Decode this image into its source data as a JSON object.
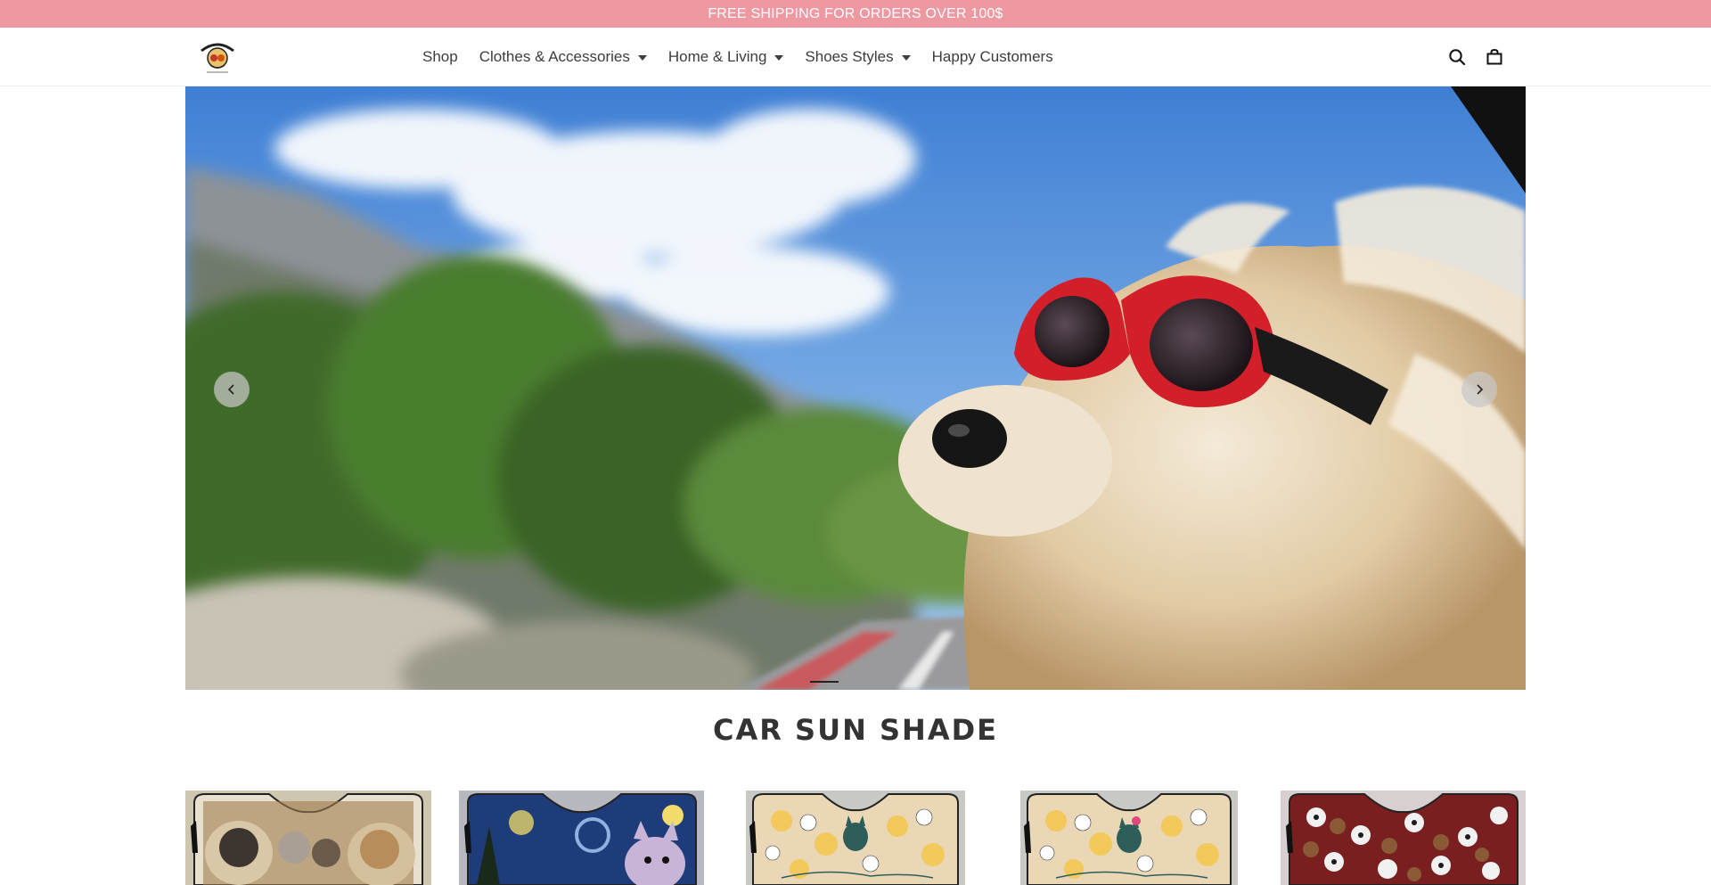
{
  "announcement": {
    "text": "FREE SHIPPING FOR ORDERS OVER 100$"
  },
  "header": {
    "logo": {
      "alt": "store logo"
    },
    "nav": [
      {
        "label": "Shop",
        "has_dropdown": false
      },
      {
        "label": "Clothes & Accessories",
        "has_dropdown": true
      },
      {
        "label": "Home & Living",
        "has_dropdown": true
      },
      {
        "label": "Shoes Styles",
        "has_dropdown": true
      },
      {
        "label": "Happy Customers",
        "has_dropdown": false
      }
    ],
    "icons": [
      "search-icon",
      "cart-icon"
    ]
  },
  "hero": {
    "slides_count": 1,
    "active_slide": 0,
    "image": "dog-with-red-goggles-in-car-window",
    "arrows": [
      "chevron-left-icon",
      "chevron-right-icon"
    ]
  },
  "section": {
    "title": "CAR SUN SHADE",
    "products": [
      {
        "image": "french-bulldogs-in-car-seats-sunshade"
      },
      {
        "image": "starry-night-french-bulldog-sunshade"
      },
      {
        "image": "frenchie-mom-floral-sunshade"
      },
      {
        "image": "frenchie-mom-floral-pink-bow-sunshade"
      },
      {
        "image": "french-bulldog-pattern-sunshade"
      }
    ]
  },
  "colors": {
    "announcement_bg": "#ee98a1",
    "text": "#3c3c3c",
    "active_dot": "#222222"
  }
}
